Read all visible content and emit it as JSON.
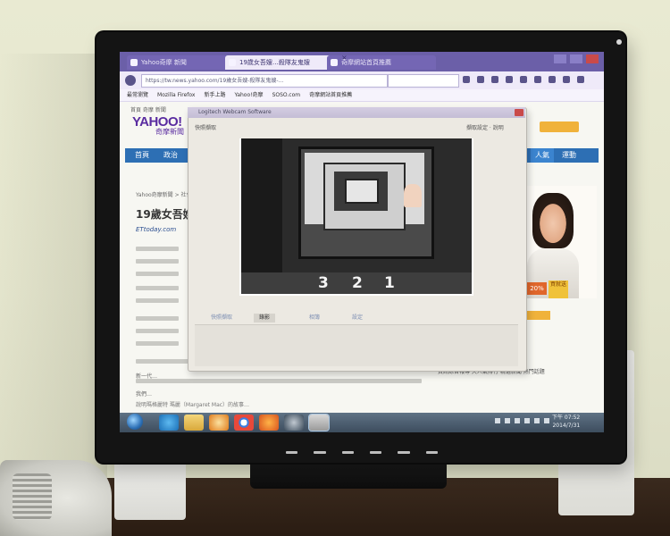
{
  "scene": {
    "description_colors": {
      "wall": "#e6e7cf",
      "desk": "#2f2117",
      "monitor_bezel": "#141414"
    },
    "monitor_brand": ""
  },
  "browser": {
    "tabs": [
      {
        "label": "Yahoo奇摩 新聞",
        "active": false
      },
      {
        "label": "19歲女吾嫂…殺隊友鬼嫂",
        "active": true
      },
      {
        "label": "奇摩網站首頁推薦",
        "active": false
      }
    ],
    "tab_close": "×",
    "url": "https://tw.news.yahoo.com/19歲女吾嫂-殺隊友鬼嫂-...",
    "bookmarks": [
      "最常瀏覽",
      "Mozilla Firefox",
      "新手上路",
      "Yahoo!奇摩",
      "SOSO.com",
      "奇摩網站首頁推薦"
    ]
  },
  "page": {
    "top_links": "首頁 奇摩 新聞",
    "logo": "YAHOO!",
    "logo_sub": "奇摩新聞",
    "nav": [
      "首頁",
      "政治",
      "人氣",
      "運動"
    ],
    "breadcrumb": "Yahoo奇摩新聞 > 社會",
    "article_title": "19歲女吾嫂",
    "source_logo": "ETtoday.com",
    "body_line_1": "新一代…",
    "body_line_2": "我們…",
    "body_line_3": "說明瑪格麗特 瑪麗（Margaret Mac）的故事…",
    "side_links": "資訊綜合報導 大人氣排行 精選新聞 熱門話題",
    "ad_badge": "20%",
    "ad_badge2": "買就送"
  },
  "webcam_app": {
    "title": "Logitech Webcam Software",
    "toolbar_left": "快照擷取",
    "toolbar_right": "擷取設定 · 說明",
    "countdown": [
      "3",
      "2",
      "1"
    ],
    "tabs": [
      "快照擷取",
      "錄影",
      "相簿",
      "設定"
    ]
  },
  "taskbar": {
    "clock_time": "下午 07:52",
    "clock_date": "2014/7/31"
  }
}
